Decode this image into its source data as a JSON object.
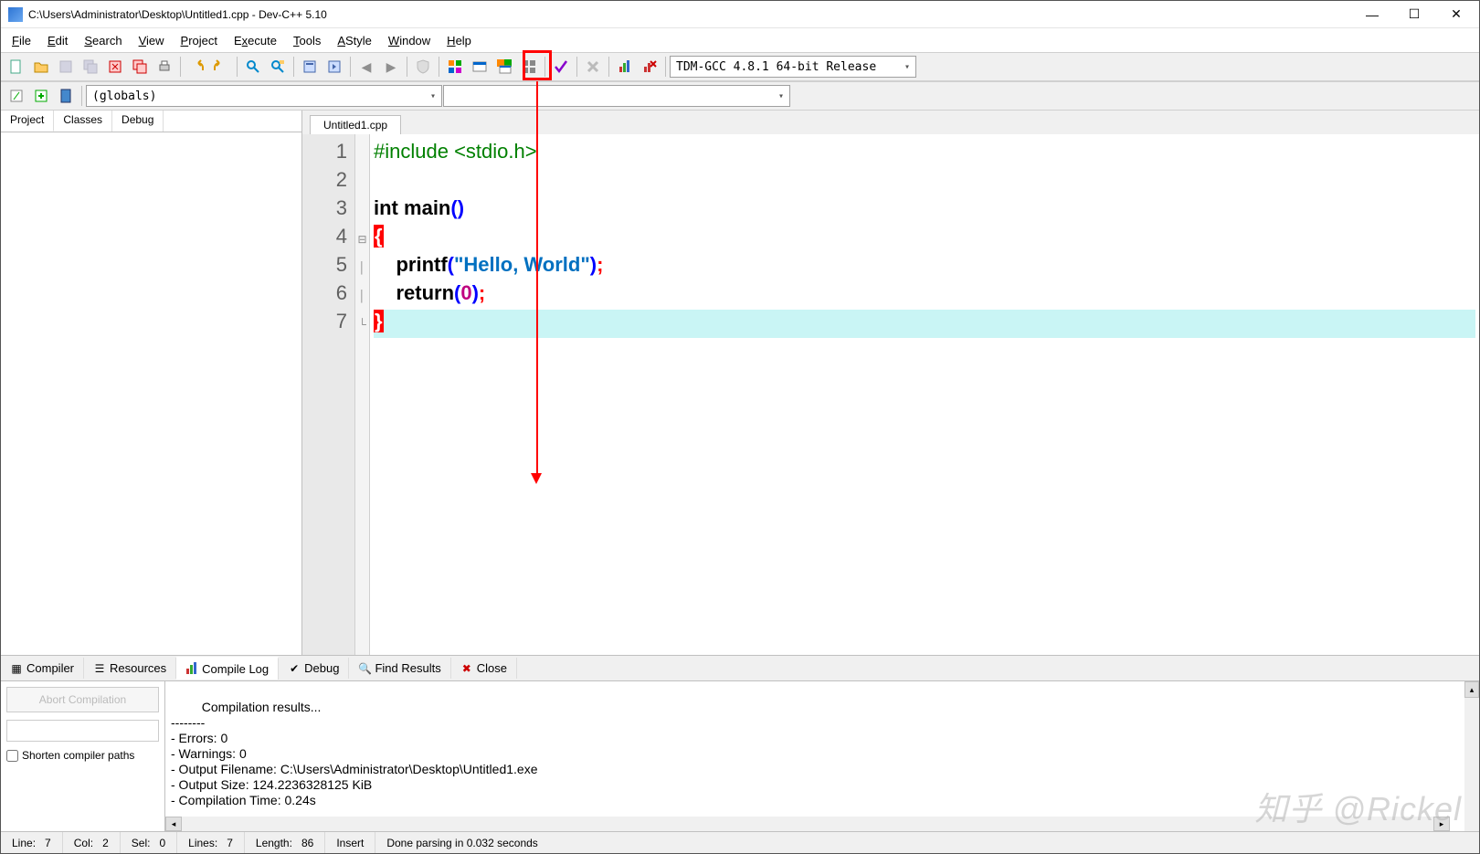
{
  "window": {
    "title": "C:\\Users\\Administrator\\Desktop\\Untitled1.cpp - Dev-C++ 5.10"
  },
  "menu": [
    "File",
    "Edit",
    "Search",
    "View",
    "Project",
    "Execute",
    "Tools",
    "AStyle",
    "Window",
    "Help"
  ],
  "compiler_combo": "TDM-GCC 4.8.1 64-bit Release",
  "scope_combo": "(globals)",
  "left_tabs": [
    "Project",
    "Classes",
    "Debug"
  ],
  "editor_tab": "Untitled1.cpp",
  "code": {
    "lines": [
      "#include <stdio.h>",
      "",
      "int main()",
      "{",
      "    printf(\"Hello, World\");",
      "    return(0);",
      "}"
    ],
    "numbers": [
      "1",
      "2",
      "3",
      "4",
      "5",
      "6",
      "7"
    ],
    "fold": [
      "",
      "",
      "",
      "⊟",
      "│",
      "│",
      "└"
    ]
  },
  "bottom_tabs": [
    {
      "label": "Compiler",
      "icon": "grid-icon"
    },
    {
      "label": "Resources",
      "icon": "stack-icon"
    },
    {
      "label": "Compile Log",
      "icon": "bars-icon"
    },
    {
      "label": "Debug",
      "icon": "check-icon"
    },
    {
      "label": "Find Results",
      "icon": "search-icon"
    },
    {
      "label": "Close",
      "icon": "x-icon"
    }
  ],
  "bp_left": {
    "abort": "Abort Compilation",
    "shorten": "Shorten compiler paths"
  },
  "compile_log": "Compilation results...\n--------\n- Errors: 0\n- Warnings: 0\n- Output Filename: C:\\Users\\Administrator\\Desktop\\Untitled1.exe\n- Output Size: 124.2236328125 KiB\n- Compilation Time: 0.24s",
  "status": {
    "line_lbl": "Line:",
    "line": "7",
    "col_lbl": "Col:",
    "col": "2",
    "sel_lbl": "Sel:",
    "sel": "0",
    "lines_lbl": "Lines:",
    "lines": "7",
    "len_lbl": "Length:",
    "len": "86",
    "mode": "Insert",
    "msg": "Done parsing in 0.032 seconds"
  },
  "watermark": "知乎 @Rickel"
}
